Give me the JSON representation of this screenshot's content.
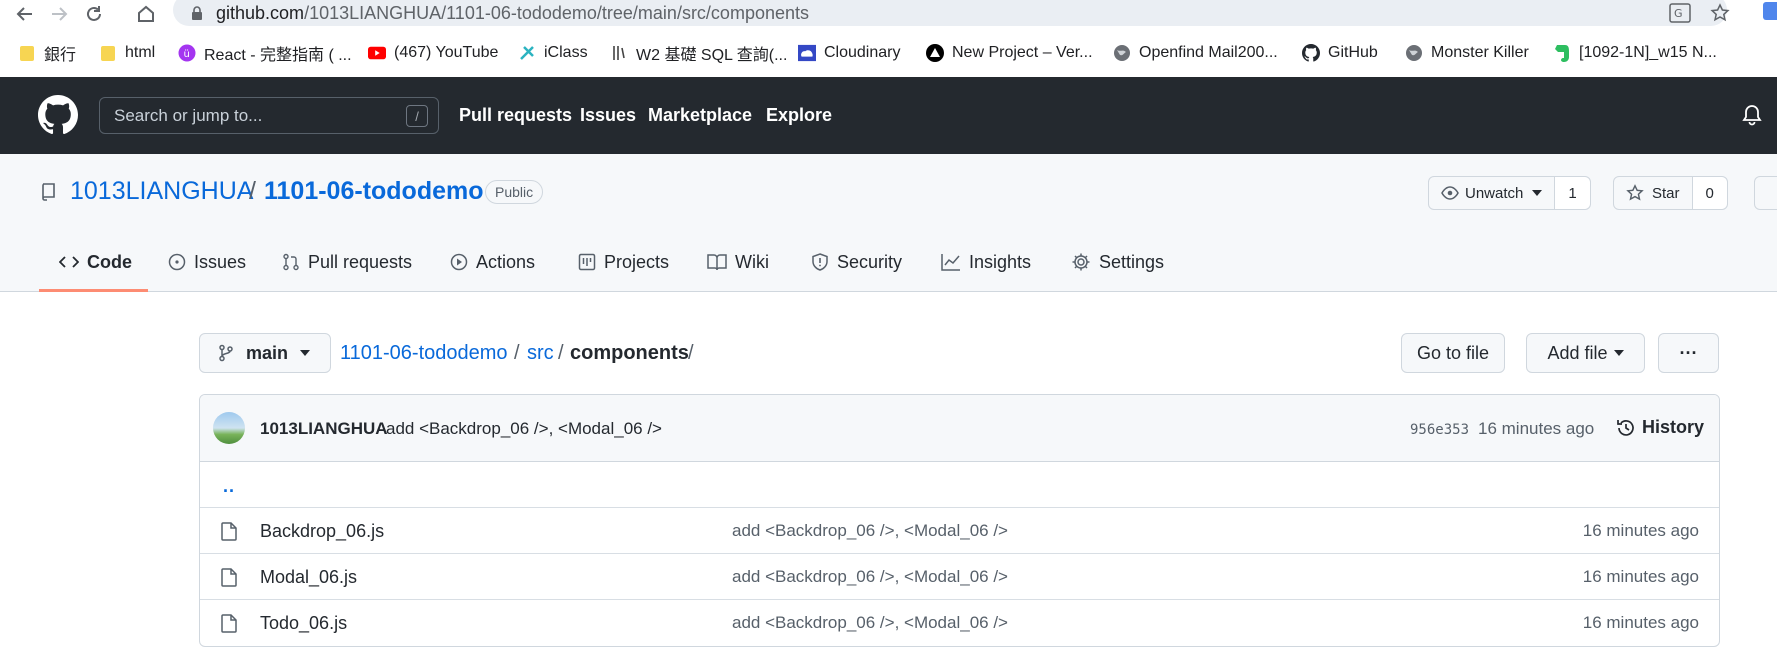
{
  "browser": {
    "url_host": "github.com",
    "url_path": "/1013LIANGHUA/1101-06-tododemo/tree/main/src/components",
    "bookmarks": [
      {
        "label": "銀行",
        "icon": "folder-icon"
      },
      {
        "label": "html",
        "icon": "folder-icon"
      },
      {
        "label": "React - 完整指南 ( ...",
        "icon": "udemy-icon"
      },
      {
        "label": "(467) YouTube",
        "icon": "youtube-icon"
      },
      {
        "label": "iClass",
        "icon": "iclass-icon"
      },
      {
        "label": "W2 基礎 SQL 查詢(...",
        "icon": "w2-icon"
      },
      {
        "label": "Cloudinary",
        "icon": "cloudinary-icon"
      },
      {
        "label": "New Project – Ver...",
        "icon": "vercel-icon"
      },
      {
        "label": "Openfind Mail200...",
        "icon": "globe-icon"
      },
      {
        "label": "GitHub",
        "icon": "github-icon"
      },
      {
        "label": "Monster Killer",
        "icon": "globe-icon"
      },
      {
        "label": "[1092-1N]_w15 N...",
        "icon": "evernote-icon"
      }
    ]
  },
  "header": {
    "search_placeholder": "Search or jump to...",
    "search_shortcut": "/",
    "nav": [
      "Pull requests",
      "Issues",
      "Marketplace",
      "Explore"
    ]
  },
  "repo": {
    "owner": "1013LIANGHUA",
    "separator": "/",
    "name": "1101-06-tododemo",
    "visibility": "Public",
    "unwatch_label": "Unwatch",
    "watch_count": "1",
    "star_label": "Star",
    "star_count": "0",
    "tabs": [
      {
        "label": "Code",
        "icon": "code-icon",
        "active": true
      },
      {
        "label": "Issues",
        "icon": "issue-icon"
      },
      {
        "label": "Pull requests",
        "icon": "pull-request-icon"
      },
      {
        "label": "Actions",
        "icon": "play-icon"
      },
      {
        "label": "Projects",
        "icon": "project-icon"
      },
      {
        "label": "Wiki",
        "icon": "book-icon"
      },
      {
        "label": "Security",
        "icon": "shield-icon"
      },
      {
        "label": "Insights",
        "icon": "graph-icon"
      },
      {
        "label": "Settings",
        "icon": "gear-icon"
      }
    ]
  },
  "browser_pane": {
    "branch": "main",
    "breadcrumb": {
      "root": "1101-06-tododemo",
      "sep1": "/",
      "src": "src",
      "sep2": "/",
      "current": "components",
      "sep3": "/"
    },
    "go_to_file": "Go to file",
    "add_file": "Add file",
    "more": "···"
  },
  "latest_commit": {
    "author": "1013LIANGHUA",
    "message": "add <Backdrop_06 />, <Modal_06 />",
    "sha": "956e353",
    "time": "16 minutes ago",
    "history_label": "History"
  },
  "files": {
    "parent": "..",
    "items": [
      {
        "name": "Backdrop_06.js",
        "message": "add <Backdrop_06 />, <Modal_06 />",
        "time": "16 minutes ago"
      },
      {
        "name": "Modal_06.js",
        "message": "add <Backdrop_06 />, <Modal_06 />",
        "time": "16 minutes ago"
      },
      {
        "name": "Todo_06.js",
        "message": "add <Backdrop_06 />, <Modal_06 />",
        "time": "16 minutes ago"
      }
    ]
  },
  "colors": {
    "header_bg": "#24292f",
    "link": "#0969da",
    "tab_underline": "#fd8c73"
  }
}
